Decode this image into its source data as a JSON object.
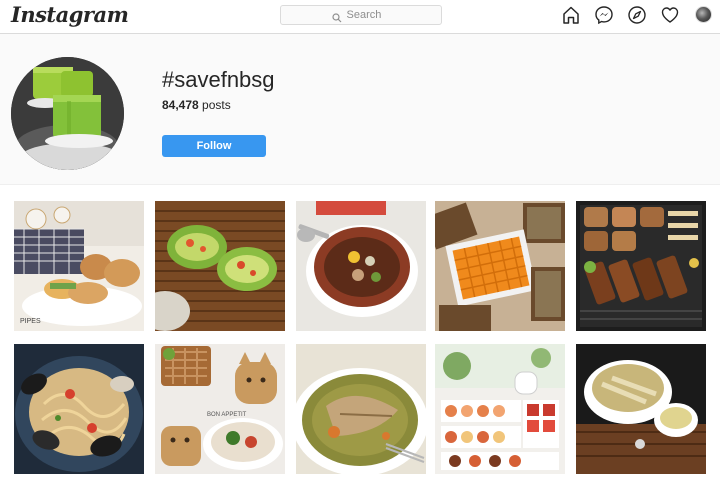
{
  "header": {
    "logo": "Instagram",
    "search_placeholder": "Search",
    "nav_icons": [
      "home-icon",
      "messenger-icon",
      "explore-icon",
      "heart-icon",
      "profile-avatar"
    ]
  },
  "hashtag": {
    "title": "#savefnbsg",
    "post_count": "84,478",
    "posts_label": "posts",
    "follow_label": "Follow"
  },
  "watermarks": {
    "pipes": "PIPES",
    "bon_appetit": "BON APPETIT"
  },
  "colors": {
    "follow_button": "#3897f0",
    "page_background": "#fafafa",
    "border": "#dbdbdb"
  }
}
